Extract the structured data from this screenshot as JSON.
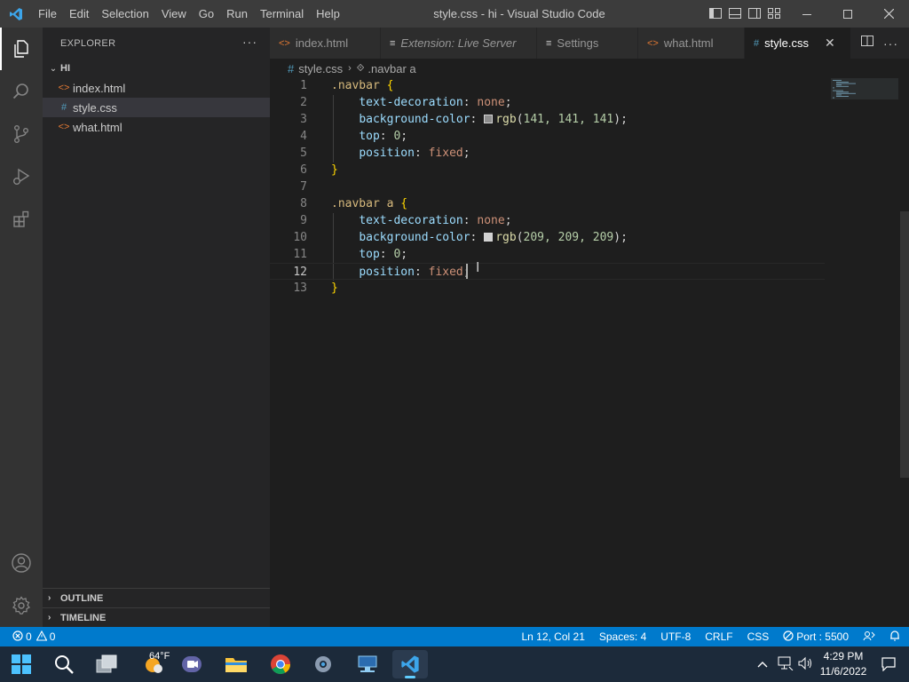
{
  "window": {
    "title": "style.css - hi - Visual Studio Code",
    "menu": [
      "File",
      "Edit",
      "Selection",
      "View",
      "Go",
      "Run",
      "Terminal",
      "Help"
    ]
  },
  "explorer": {
    "header": "EXPLORER",
    "more": "···",
    "folder": "HI",
    "files": [
      {
        "name": "index.html",
        "icon": "<>",
        "selected": false
      },
      {
        "name": "style.css",
        "icon": "#",
        "selected": true
      },
      {
        "name": "what.html",
        "icon": "<>",
        "selected": false
      }
    ],
    "outline_label": "OUTLINE",
    "timeline_label": "TIMELINE"
  },
  "tabs": [
    {
      "label": "index.html",
      "icon": "<>",
      "active": false,
      "italic": false
    },
    {
      "label": "Extension: Live Server",
      "icon": "≡",
      "active": false,
      "italic": true
    },
    {
      "label": "Settings",
      "icon": "≡",
      "active": false,
      "italic": false
    },
    {
      "label": "what.html",
      "icon": "<>",
      "active": false,
      "italic": false
    },
    {
      "label": "style.css",
      "icon": "#",
      "active": true,
      "italic": false
    }
  ],
  "breadcrumb": {
    "file": "style.css",
    "symbol": ".navbar a"
  },
  "editor": {
    "current_line": 12,
    "lines": [
      {
        "n": "1",
        "sel": ".navbar",
        "brace": "{"
      },
      {
        "n": "2",
        "prop": "text-decoration",
        "val": "none"
      },
      {
        "n": "3",
        "prop": "background-color",
        "fn": "rgb",
        "args": "141, 141, 141",
        "swatch": "#8d8d8d"
      },
      {
        "n": "4",
        "prop": "top",
        "num": "0"
      },
      {
        "n": "5",
        "prop": "position",
        "val": "fixed"
      },
      {
        "n": "6",
        "brace": "}"
      },
      {
        "n": "7"
      },
      {
        "n": "8",
        "sel": ".navbar a",
        "brace": "{"
      },
      {
        "n": "9",
        "prop": "text-decoration",
        "val": "none"
      },
      {
        "n": "10",
        "prop": "background-color",
        "fn": "rgb",
        "args": "209, 209, 209",
        "swatch": "#d1d1d1"
      },
      {
        "n": "11",
        "prop": "top",
        "num": "0"
      },
      {
        "n": "12",
        "prop": "position",
        "val": "fixed"
      },
      {
        "n": "13",
        "brace": "}"
      }
    ]
  },
  "statusbar": {
    "errors": "0",
    "warnings": "0",
    "position": "Ln 12, Col 21",
    "spaces": "Spaces: 4",
    "encoding": "UTF-8",
    "eol": "CRLF",
    "language": "CSS",
    "port": "Port : 5500"
  },
  "taskbar": {
    "weather": "64°F",
    "time": "4:29 PM",
    "date": "11/6/2022"
  },
  "colors": {
    "accent": "#007acc",
    "selector": "#d7ba7d",
    "property": "#9cdcfe",
    "value": "#ce9178",
    "number": "#b5cea8",
    "function": "#dcdcaa",
    "brace": "#ffd700"
  }
}
